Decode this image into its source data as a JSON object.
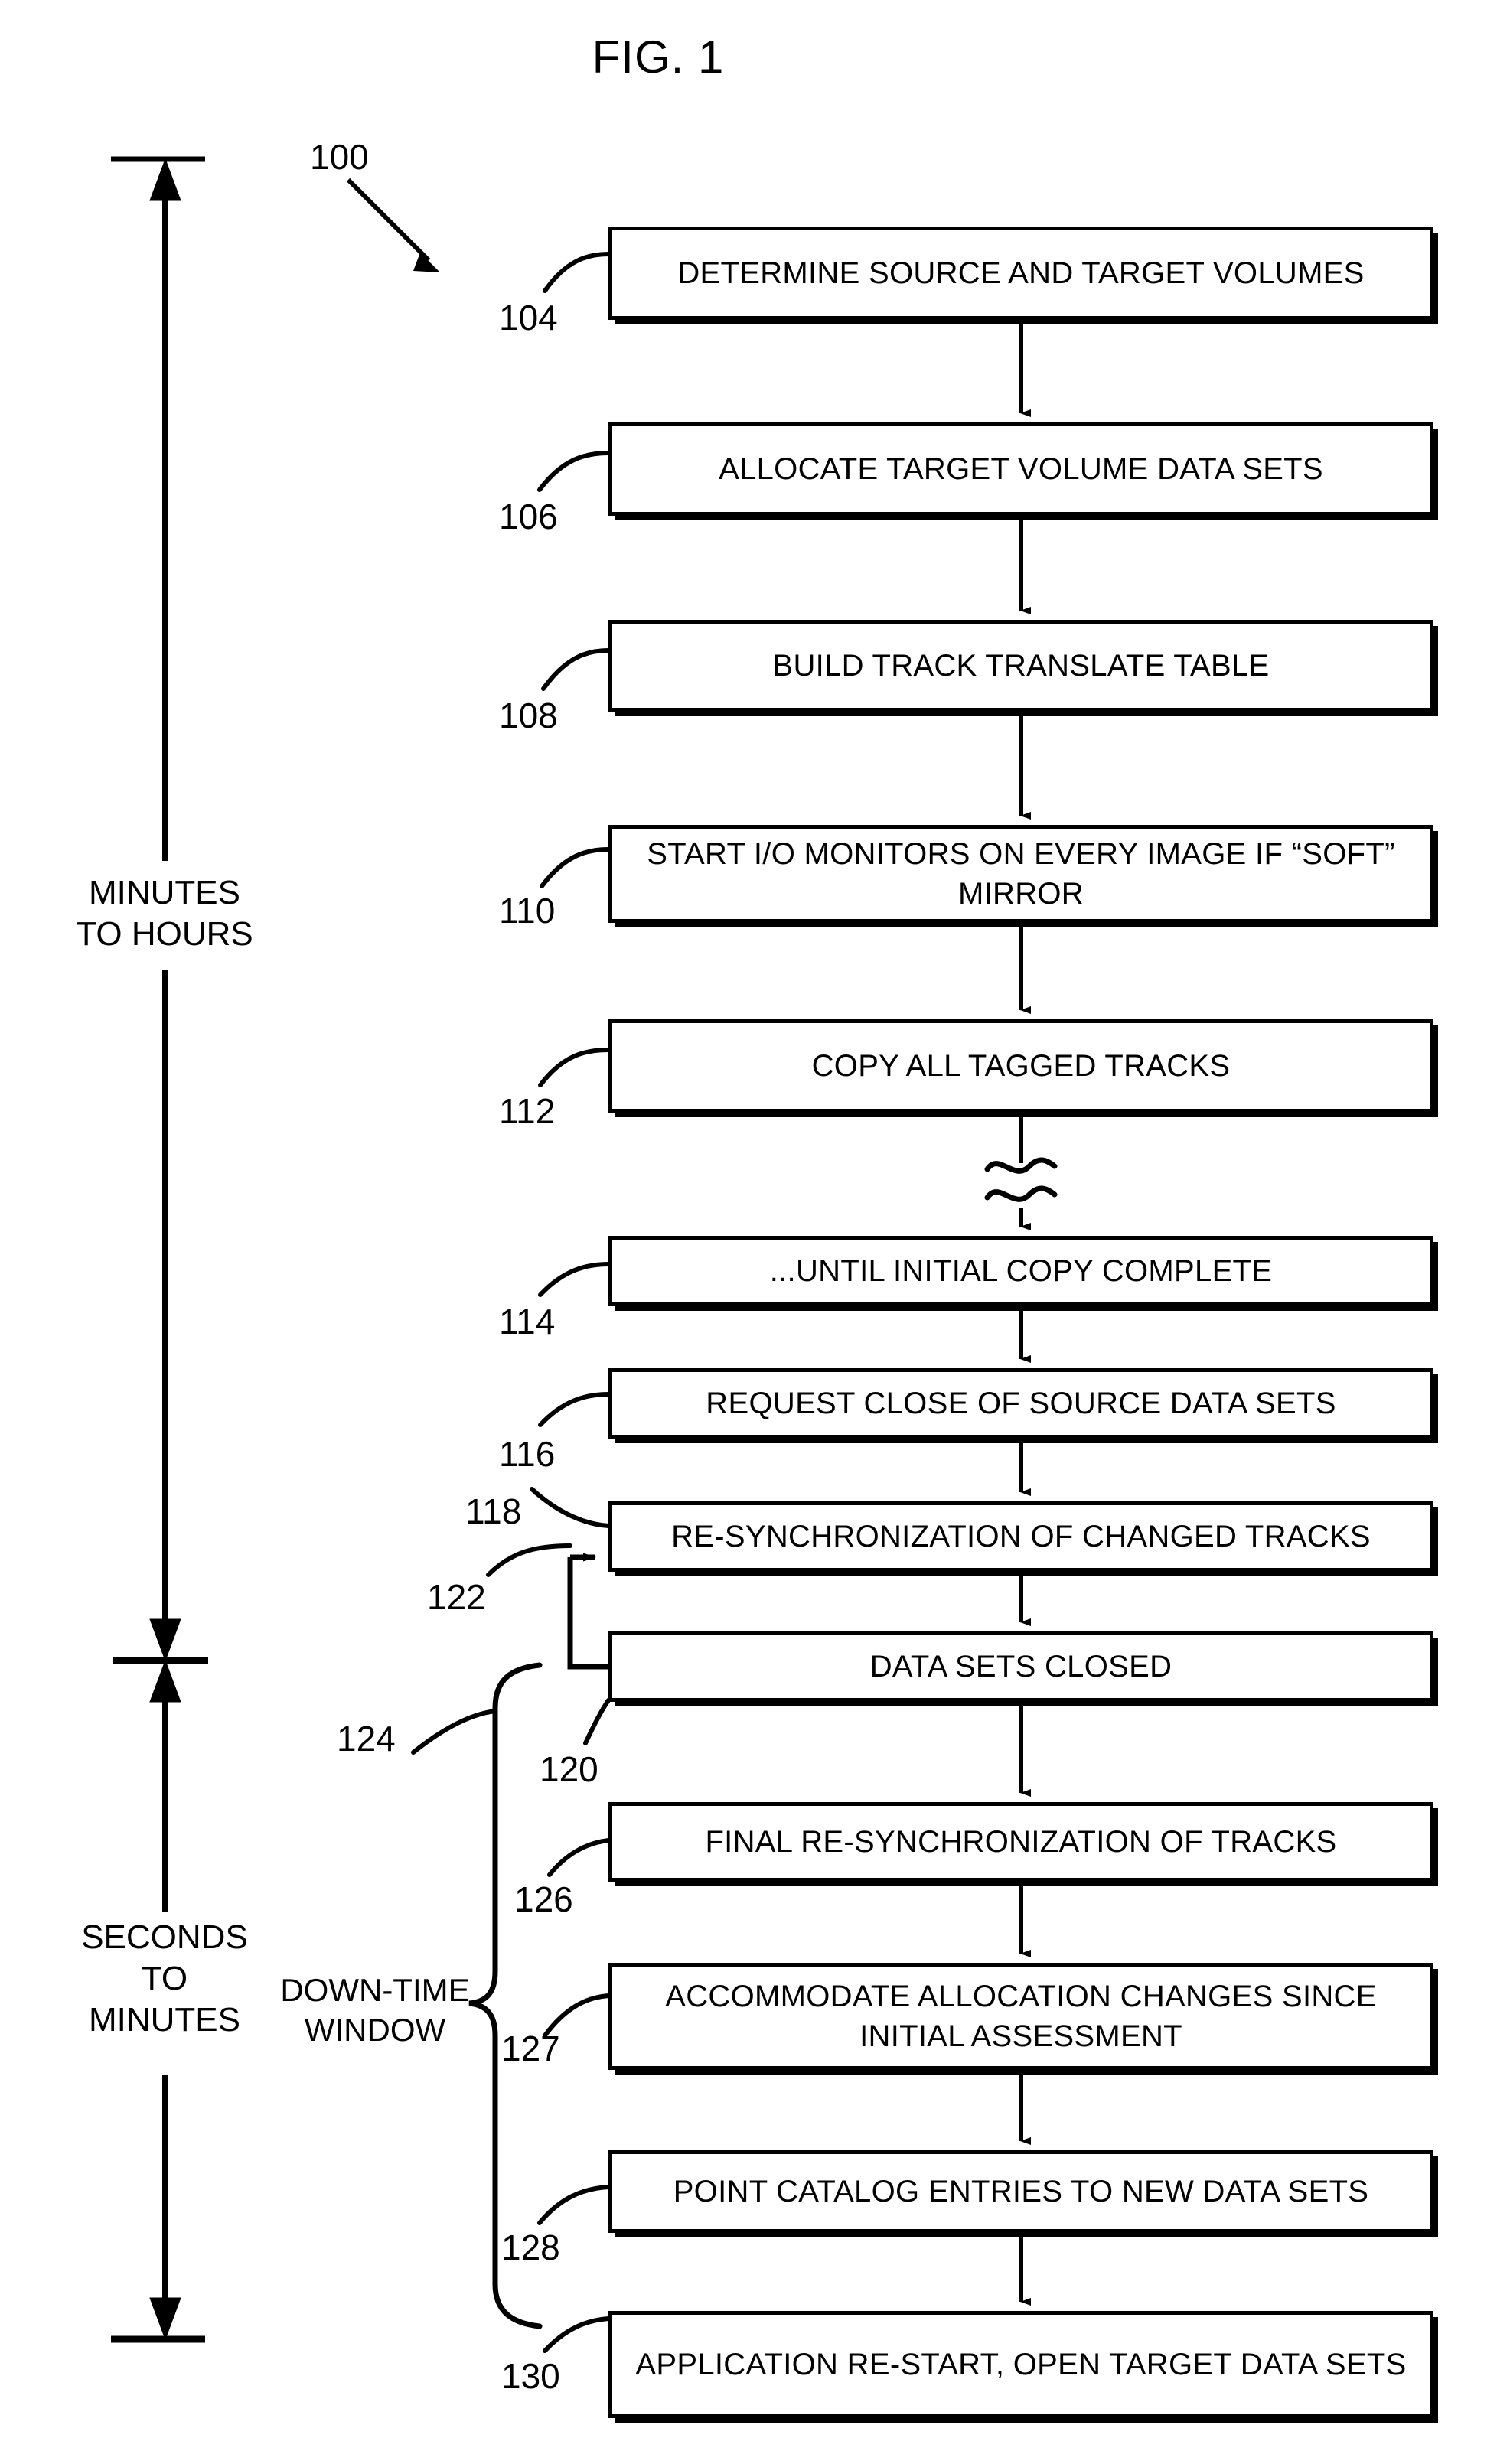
{
  "figure": {
    "title": "FIG. 1",
    "diagram_ref": "100"
  },
  "timeline": {
    "upper_label": "MINUTES\nTO HOURS",
    "lower_label": "SECONDS\nTO\nMINUTES",
    "bracket_label": "DOWN-TIME\nWINDOW",
    "bracket_ref": "124"
  },
  "steps": [
    {
      "ref": "104",
      "text": "DETERMINE SOURCE AND TARGET VOLUMES"
    },
    {
      "ref": "106",
      "text": "ALLOCATE TARGET VOLUME DATA SETS"
    },
    {
      "ref": "108",
      "text": "BUILD TRACK TRANSLATE TABLE"
    },
    {
      "ref": "110",
      "text": "START I/O MONITORS ON EVERY IMAGE IF “SOFT” MIRROR"
    },
    {
      "ref": "112",
      "text": "COPY ALL TAGGED TRACKS"
    },
    {
      "ref": "114",
      "text": "...UNTIL INITIAL COPY COMPLETE"
    },
    {
      "ref": "116",
      "text": "REQUEST CLOSE OF SOURCE DATA SETS"
    },
    {
      "ref": "118",
      "text": "RE-SYNCHRONIZATION OF CHANGED TRACKS"
    },
    {
      "ref": "120",
      "text": "DATA SETS CLOSED"
    },
    {
      "ref": "126",
      "text": "FINAL RE-SYNCHRONIZATION OF TRACKS"
    },
    {
      "ref": "127",
      "text": "ACCOMMODATE ALLOCATION CHANGES SINCE INITIAL ASSESSMENT"
    },
    {
      "ref": "128",
      "text": "POINT CATALOG ENTRIES TO NEW DATA SETS"
    },
    {
      "ref": "130",
      "text": "APPLICATION RE-START, OPEN TARGET DATA SETS"
    }
  ],
  "feedback": {
    "ref": "122"
  },
  "colors": {
    "ink": "#000000",
    "paper": "#ffffff"
  }
}
